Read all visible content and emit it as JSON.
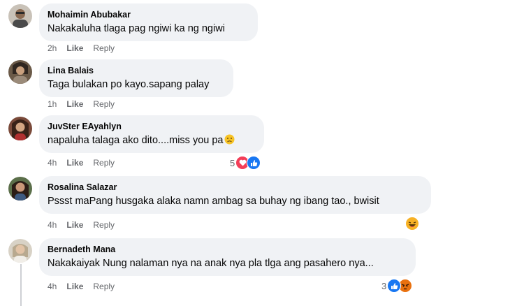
{
  "comments": [
    {
      "author": "Mohaimin Abubakar",
      "text": "Nakakaluha tlaga pag ngiwi ka ng ngiwi",
      "time": "2h",
      "like": "Like",
      "reply": "Reply"
    },
    {
      "author": "Lina Balais",
      "text": "Taga bulakan po kayo.sapang palay",
      "time": "1h",
      "like": "Like",
      "reply": "Reply"
    },
    {
      "author": "JuvSter EAyahlyn",
      "text": "napaluha talaga ako dito....miss you pa",
      "time": "4h",
      "like": "Like",
      "reply": "Reply",
      "reaction_count": "5",
      "reactions": [
        "heart-icon",
        "like-icon"
      ]
    },
    {
      "author": "Rosalina Salazar",
      "text": "Pssst maPang husgaka alaka namn ambag sa buhay ng ibang tao., bwisit",
      "time": "4h",
      "like": "Like",
      "reply": "Reply",
      "reactions": [
        "haha-icon"
      ]
    },
    {
      "author": "Bernadeth Mana",
      "text": "Nakakaiyak Nung nalaman nya na anak nya pla tlga ang pasahero nya...",
      "time": "4h",
      "like": "Like",
      "reply": "Reply",
      "reaction_count": "3",
      "reactions": [
        "like-icon",
        "angry-icon"
      ]
    }
  ],
  "colors": {
    "bubble": "#f0f2f5",
    "meta": "#65676b",
    "like_blue": "#1877f2",
    "heart_red": "#f33e58",
    "haha_yellow": "#f7b125",
    "angry_orange": "#e9710f"
  }
}
